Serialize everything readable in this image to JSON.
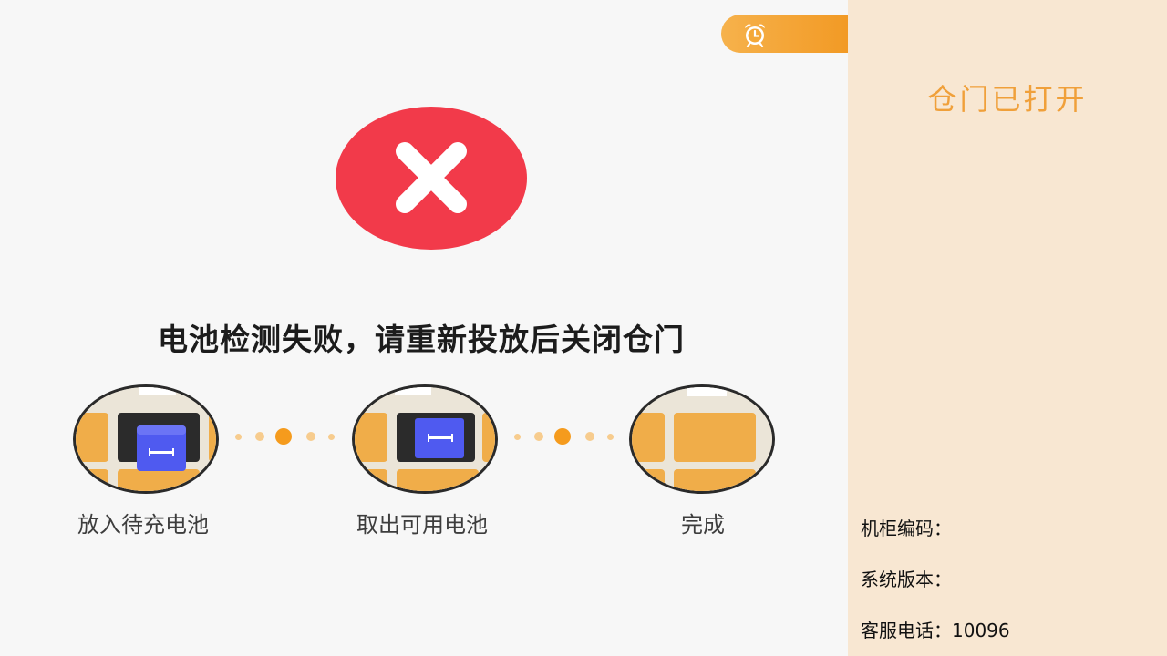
{
  "main": {
    "message": "电池检测失败，请重新投放后关闭仓门",
    "steps": [
      {
        "label": "放入待充电池",
        "icon": "insert-battery-illustration"
      },
      {
        "label": "取出可用电池",
        "icon": "remove-battery-illustration"
      },
      {
        "label": "完成",
        "icon": "done-illustration"
      }
    ],
    "status_icon": "error-x-icon",
    "timer_icon": "alarm-clock-icon"
  },
  "side": {
    "title": "仓门已打开",
    "cabinet_code_label": "机柜编码：",
    "system_version_label": "系统版本：",
    "service_phone_label": "客服电话：10096"
  },
  "colors": {
    "accent": "#f29a25",
    "error": "#f23a4a",
    "side_bg": "#f8e7d2",
    "title": "#f0a03a",
    "battery": "#4f5af0"
  }
}
